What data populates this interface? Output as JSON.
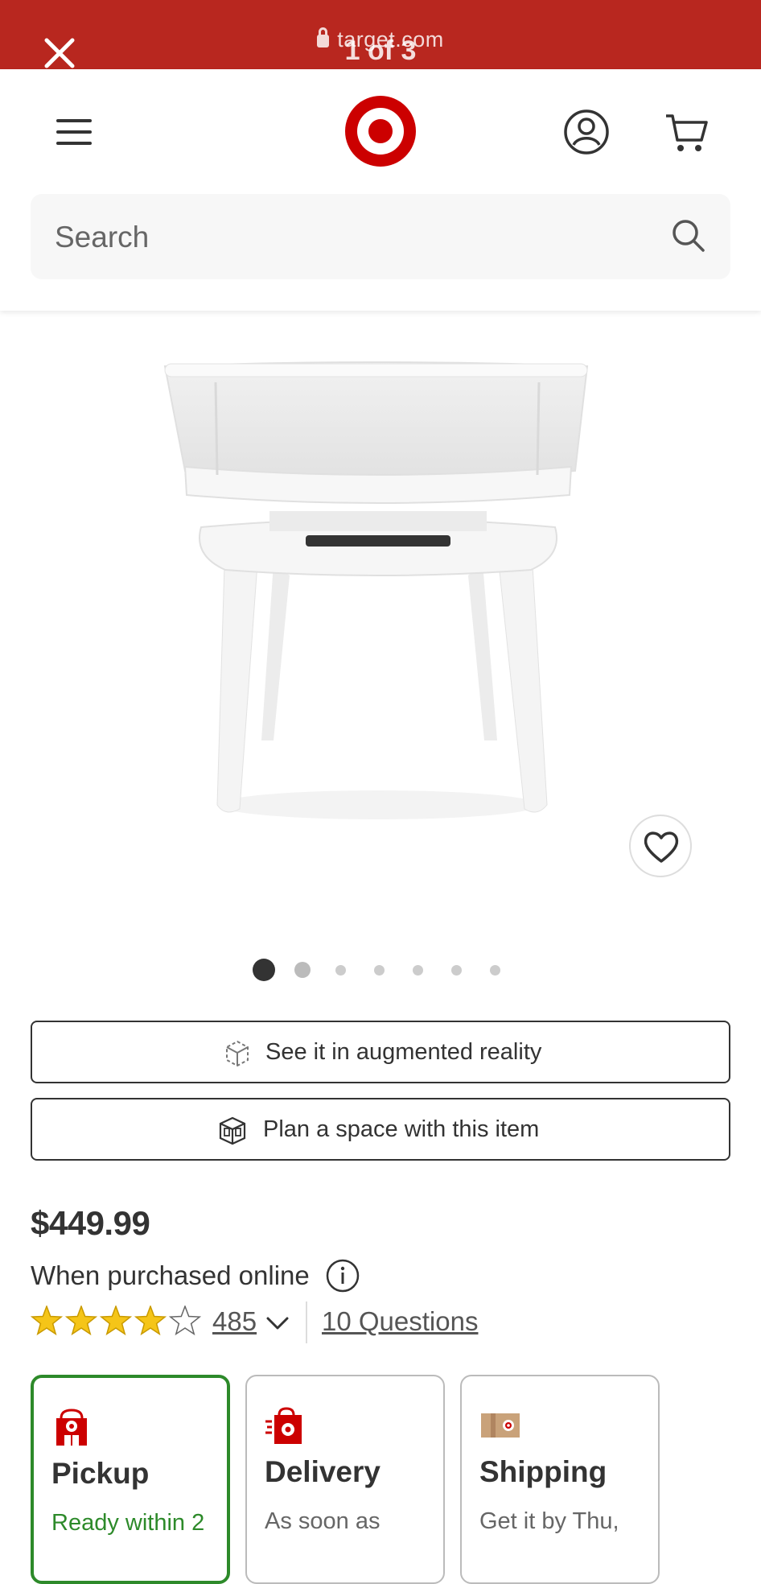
{
  "browser": {
    "url": "target.com",
    "image_counter": "1 of 3"
  },
  "header": {
    "search_placeholder": "Search"
  },
  "gallery": {
    "dot_count": 7,
    "active_index": 0
  },
  "actions": {
    "ar_label": "See it in augmented reality",
    "plan_label": "Plan a space with this item"
  },
  "product": {
    "price": "$449.99",
    "price_note": "When purchased online",
    "rating_stars": 4,
    "rating_max": 5,
    "review_count": "485",
    "questions": "10 Questions"
  },
  "fulfillment": [
    {
      "title": "Pickup",
      "subtitle": "Ready within 2",
      "selected": true
    },
    {
      "title": "Delivery",
      "subtitle": "As soon as",
      "selected": false
    },
    {
      "title": "Shipping",
      "subtitle": "Get it by Thu,",
      "selected": false
    }
  ],
  "colors": {
    "brand_red": "#cc0000",
    "bar_red": "#b8271f",
    "selected_green": "#2d8a2a",
    "star_gold": "#f5c518"
  }
}
